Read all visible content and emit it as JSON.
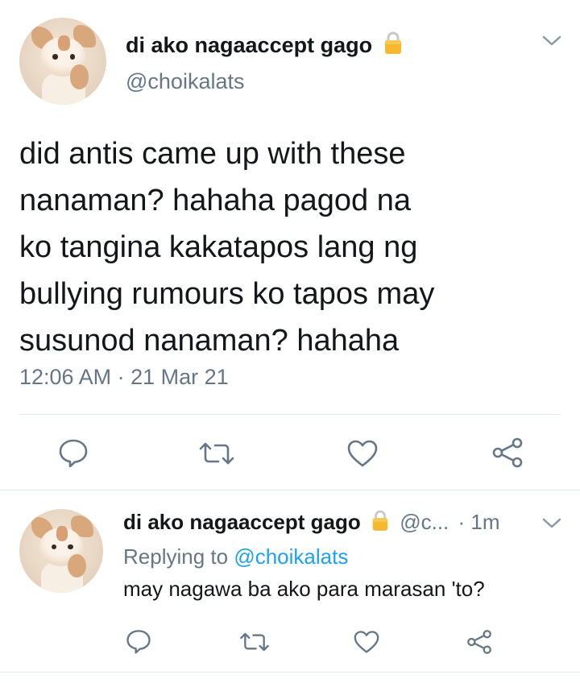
{
  "main_tweet": {
    "display_name": "di ako nagaaccept gago",
    "handle": "@choikalats",
    "text": "did antis came up with these\nnanaman? hahaha pagod na\nko tangina kakatapos lang ng\nbullying rumours ko tapos may\nsusunod nanaman? hahaha",
    "timestamp": "12:06 AM · 21 Mar 21",
    "icons": {
      "lock": "lock-icon",
      "menu": "chevron-down-icon",
      "reply": "reply-icon",
      "retweet": "retweet-icon",
      "like": "heart-icon",
      "share": "share-icon"
    }
  },
  "reply_tweet": {
    "display_name": "di ako nagaaccept gago",
    "handle_truncated": "@c...",
    "time_ago": "· 1m",
    "replying_prefix": "Replying to",
    "replying_mention": "@choikalats",
    "text": "may nagawa ba ako para marasan 'to?"
  },
  "colors": {
    "text_primary": "#14171a",
    "text_secondary": "#657786",
    "link": "#1da1f2",
    "divider": "#e1e8ed",
    "lock_gold": "#f5b82e"
  }
}
